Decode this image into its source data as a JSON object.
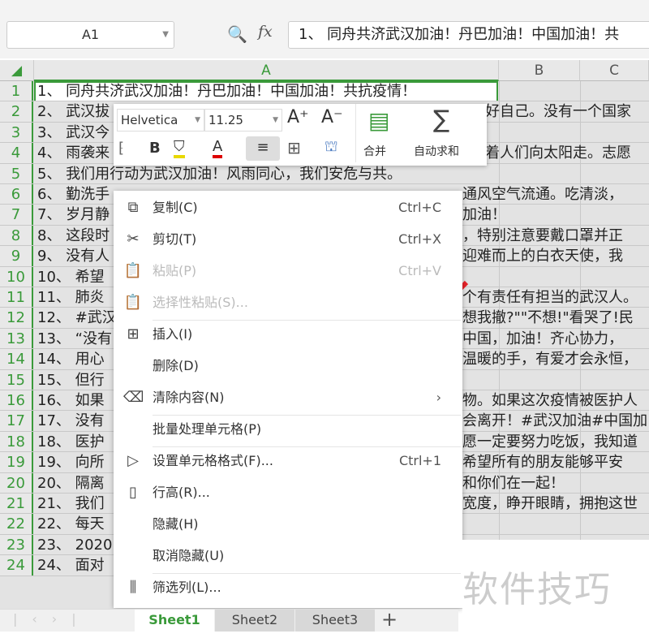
{
  "namebox": "A1",
  "formula": "1、 同舟共济武汉加油！丹巴加油！中国加油！共",
  "columns": [
    "A",
    "B",
    "C"
  ],
  "rows": [
    {
      "n": "1",
      "left": "1、 同舟共济武汉加油！丹巴加油！中国加油！共抗疫情！",
      "right": ""
    },
    {
      "n": "2",
      "left": "2、 武汉拔",
      "right": "好自己。没有一个国家"
    },
    {
      "n": "3",
      "left": "3、 武汉今",
      "right": ""
    },
    {
      "n": "4",
      "left": "4、 雨袭来",
      "right": "着人们向太阳走。志愿"
    },
    {
      "n": "5",
      "left": "5、 我们用行动为武汉加油！风雨同心，我们安危与共。",
      "right": ""
    },
    {
      "n": "6",
      "left": "6、 勤洗手",
      "right": "通风空气流通。吃清淡，"
    },
    {
      "n": "7",
      "left": "7、 岁月静",
      "right": "加油！"
    },
    {
      "n": "8",
      "left": "8、 这段时",
      "right": "，特别注意要戴口罩并正"
    },
    {
      "n": "9",
      "left": "9、 没有人",
      "right": "迎难而上的白衣天使，我"
    },
    {
      "n": "10",
      "left": "10、 希望",
      "right": ""
    },
    {
      "n": "11",
      "left": "11、 肺炎",
      "right": "个有责任有担当的武汉人。"
    },
    {
      "n": "12",
      "left": "12、 #武汉",
      "right": "想我撤?\"\"不想!\"看哭了!民"
    },
    {
      "n": "13",
      "left": "13、 “没有",
      "right": " 中国，加油！齐心协力，"
    },
    {
      "n": "14",
      "left": "14、 用心",
      "right": "温暖的手，有爱才会永恒，"
    },
    {
      "n": "15",
      "left": "15、 但行",
      "right": ""
    },
    {
      "n": "16",
      "left": "16、 如果",
      "right": "物。如果这次疫情被医护人"
    },
    {
      "n": "17",
      "left": "17、 没有",
      "right": "会离开！#武汉加油#中国加"
    },
    {
      "n": "18",
      "left": "18、 医护",
      "right": "愿一定要努力吃饭，我知道"
    },
    {
      "n": "19",
      "left": "19、 向所",
      "right": "  希望所有的朋友能够平安"
    },
    {
      "n": "20",
      "left": "20、 隔离",
      "right": "和你们在一起！"
    },
    {
      "n": "21",
      "left": "21、 我们",
      "right": "宽度，睁开眼睛，拥抱这世"
    },
    {
      "n": "22",
      "left": "22、 每天",
      "right": ""
    },
    {
      "n": "23",
      "left": "23、 2020",
      "right": ""
    },
    {
      "n": "24",
      "left": "24、 面对",
      "right": ""
    }
  ],
  "toolbar": {
    "font": "Helvetica",
    "size": "11.25",
    "merge": "合并",
    "autosum": "自动求和"
  },
  "menu": [
    {
      "icon": "copy-icon",
      "glyph": "⧉",
      "label": "复制(C)",
      "shortcut": "Ctrl+C",
      "disabled": false
    },
    {
      "icon": "cut-icon",
      "glyph": "✂",
      "label": "剪切(T)",
      "shortcut": "Ctrl+X",
      "disabled": false
    },
    {
      "icon": "paste-icon",
      "glyph": "📋",
      "label": "粘贴(P)",
      "shortcut": "Ctrl+V",
      "disabled": true
    },
    {
      "icon": "paste-special-icon",
      "glyph": "📋",
      "label": "选择性粘贴(S)...",
      "shortcut": "",
      "disabled": true
    },
    {
      "icon": "insert-icon",
      "glyph": "⊞",
      "label": "插入(I)",
      "shortcut": "",
      "disabled": false
    },
    {
      "icon": "",
      "glyph": "",
      "label": "删除(D)",
      "shortcut": "",
      "disabled": false
    },
    {
      "icon": "clear-icon",
      "glyph": "⌫",
      "label": "清除内容(N)",
      "shortcut": "›",
      "disabled": false
    },
    {
      "icon": "",
      "glyph": "",
      "label": "批量处理单元格(P)",
      "shortcut": "",
      "disabled": false
    },
    {
      "icon": "format-cells-icon",
      "glyph": "▷",
      "label": "设置单元格格式(F)...",
      "shortcut": "Ctrl+1",
      "disabled": false
    },
    {
      "icon": "row-height-icon",
      "glyph": "▯",
      "label": "行高(R)...",
      "shortcut": "",
      "disabled": false
    },
    {
      "icon": "",
      "glyph": "",
      "label": "隐藏(H)",
      "shortcut": "",
      "disabled": false
    },
    {
      "icon": "",
      "glyph": "",
      "label": "取消隐藏(U)",
      "shortcut": "",
      "disabled": false
    },
    {
      "icon": "filter-column-icon",
      "glyph": "⫼",
      "label": "筛选列(L)...",
      "shortcut": "",
      "disabled": false
    }
  ],
  "sheets": [
    "Sheet1",
    "Sheet2",
    "Sheet3"
  ],
  "add_sheet": "+",
  "watermark": "软件技巧",
  "colors": {
    "accent": "#3a9a3a",
    "arrow": "#e8232a"
  }
}
